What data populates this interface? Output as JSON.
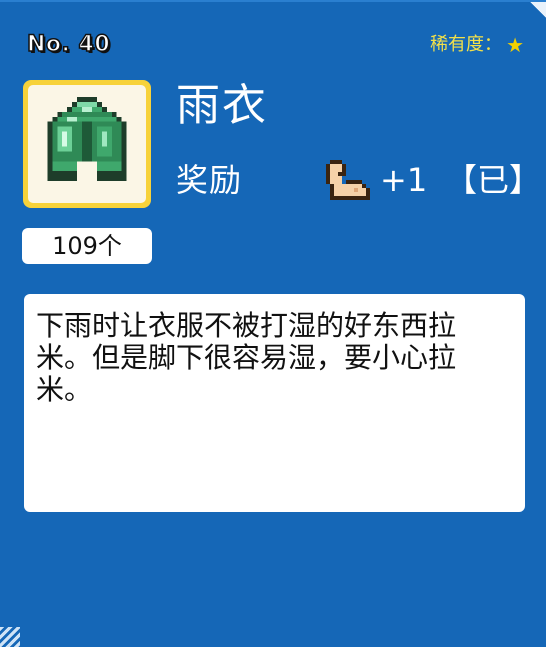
{
  "item": {
    "number_label": "No. 40",
    "rarity_label": "稀有度：",
    "rarity_stars": "★",
    "name": "雨衣",
    "icon": "green-raincoat-icon",
    "count": "109个"
  },
  "reward": {
    "label": "奖励",
    "icon": "flexed-arm-icon",
    "value": "+1",
    "status": "【已】"
  },
  "description": {
    "text": "下雨时让衣服不被打湿的好东西拉米。但是脚下很容易湿，要小心拉米。"
  },
  "colors": {
    "background": "#1567b7",
    "frame": "#f7d23a",
    "rarity": "#f2e04a"
  }
}
